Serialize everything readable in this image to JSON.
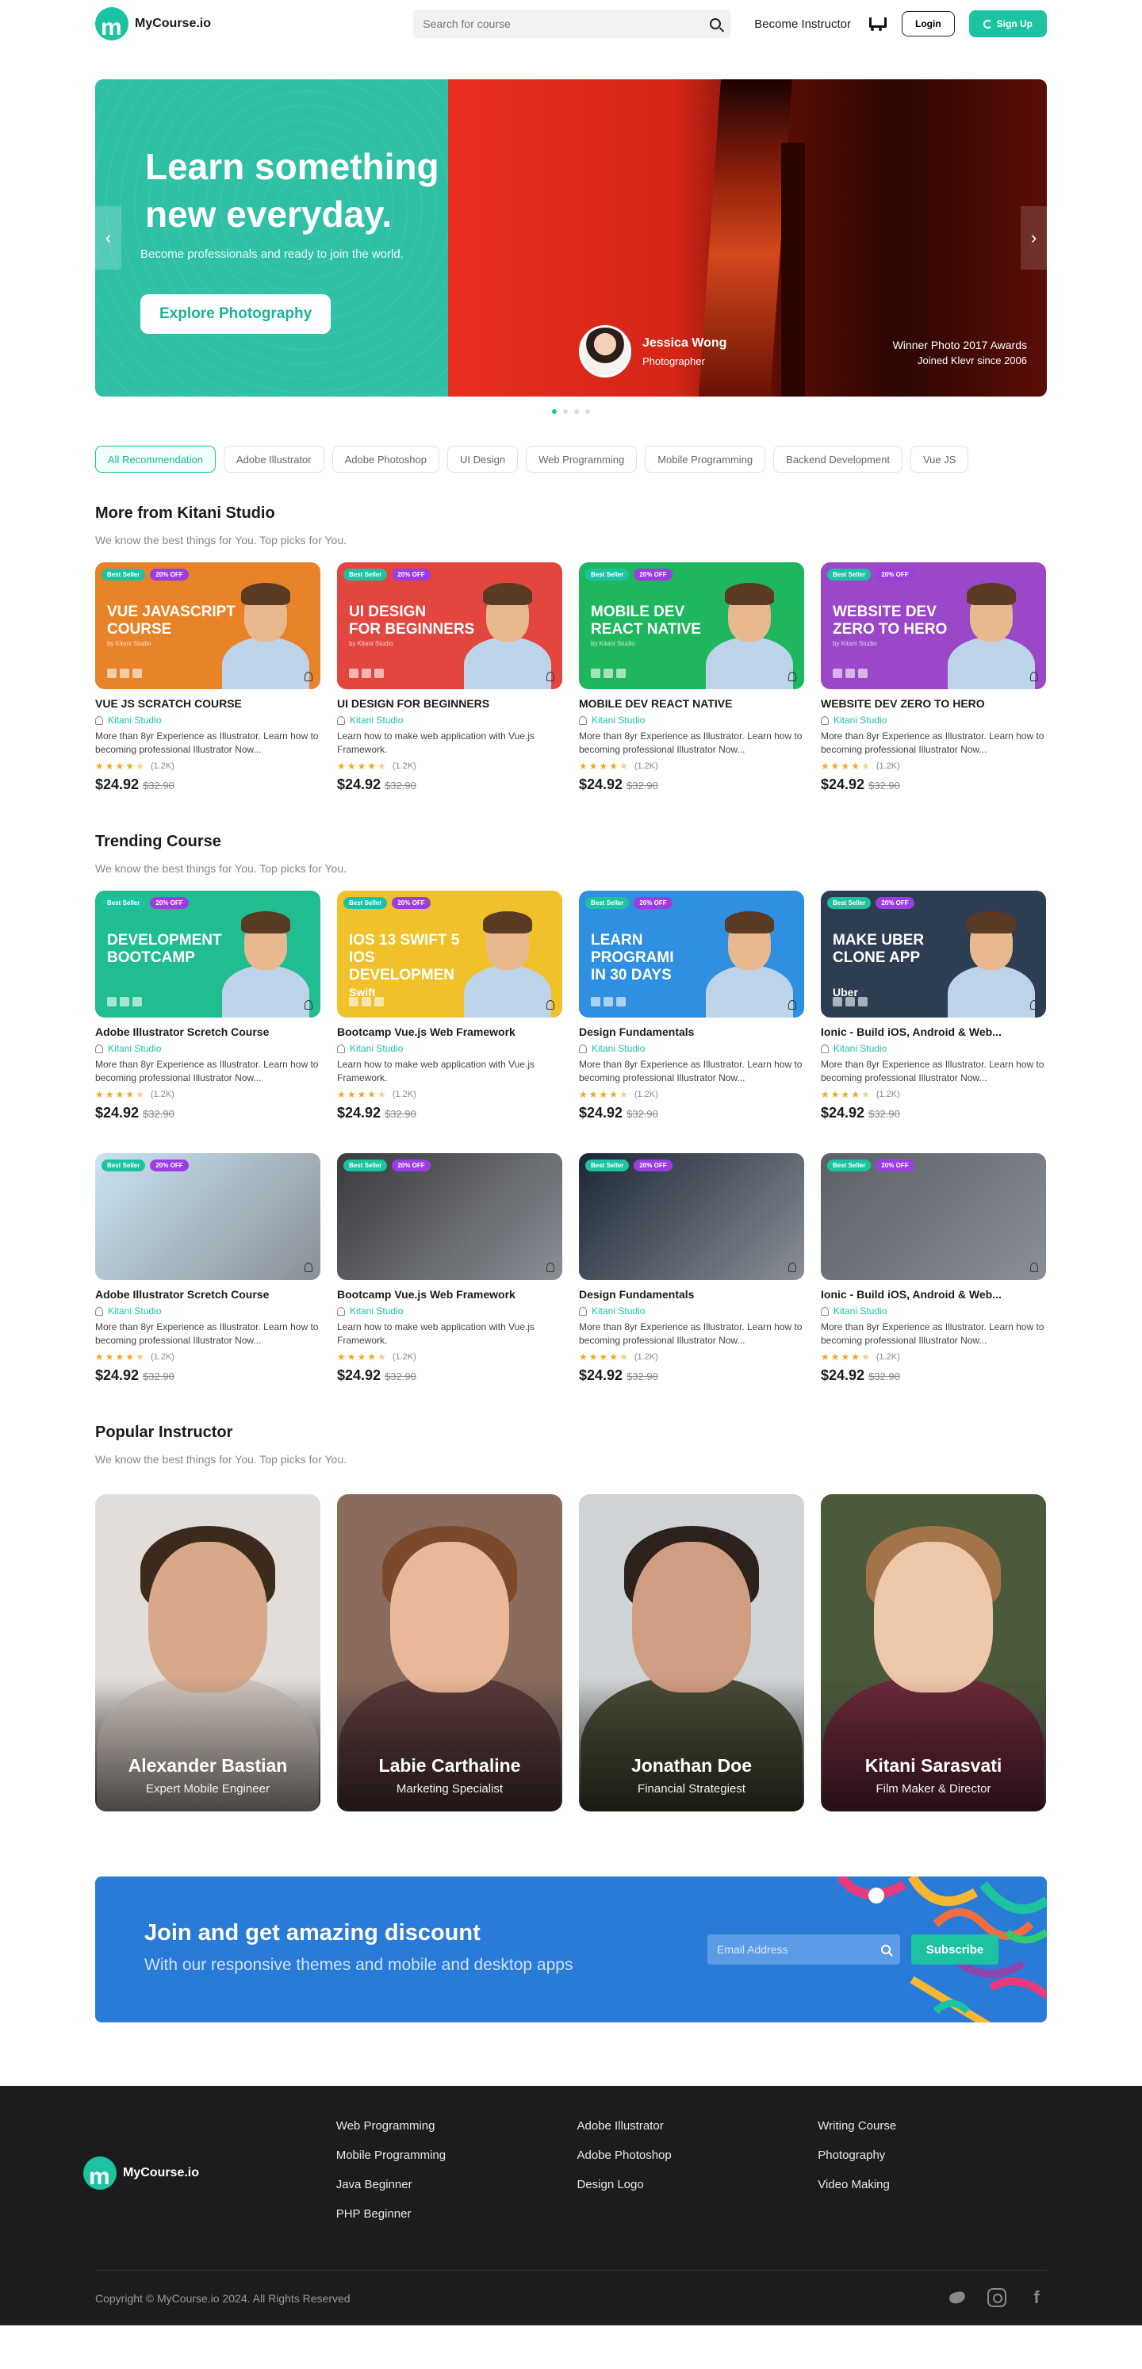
{
  "header": {
    "logo_text": "MyCourse.io",
    "search_placeholder": "Search for course",
    "become_instructor": "Become Instructor",
    "login": "Login",
    "signup": "Sign Up"
  },
  "hero": {
    "title": "Learn something new everyday.",
    "subtitle": "Become professionals and ready to join the world.",
    "button": "Explore Photography",
    "person_name": "Jessica Wong",
    "person_role": "Photographer",
    "award_line1": "Winner Photo 2017 Awards",
    "award_line2": "Joined Klevr since 2006",
    "prev_arrow": "‹",
    "next_arrow": "›",
    "slide_count": 4,
    "active_slide": 1
  },
  "filters": [
    "All Recommendation",
    "Adobe Illustrator",
    "Adobe Photoshop",
    "UI Design",
    "Web Programming",
    "Mobile Programming",
    "Backend Development",
    "Vue JS"
  ],
  "active_filter": 0,
  "sections": {
    "kitani": {
      "title": "More from Kitani Studio",
      "subtitle": "We know the best things for You.  Top picks for You."
    },
    "trending": {
      "title": "Trending Course",
      "subtitle": "We know the best things for You.  Top picks for You."
    },
    "popular": {
      "title": "Popular Instructor",
      "subtitle": "We know the best things for You.  Top picks for You."
    }
  },
  "card_common": {
    "badge1": "Best Seller",
    "badge2": "20% OFF",
    "author": "Kitani Studio",
    "byline": "by Kitani Studio",
    "reviews": "(1.2K)",
    "price": "$24.92",
    "old_price": "$32.90",
    "rating": 4.5
  },
  "kitani_cards": [
    {
      "thumb_text": "VUE JAVASCRIPT\nCOURSE",
      "title": "VUE JS SCRATCH COURSE",
      "desc": "More than 8yr Experience as Illustrator. Learn how to becoming professional Illustrator Now...",
      "color": "#e8832a"
    },
    {
      "thumb_text": "UI DESIGN\nFOR BEGINNERS",
      "title": "UI DESIGN FOR BEGINNERS",
      "desc": "Learn how to make web application with Vue.js Framework.",
      "color": "#e2463f"
    },
    {
      "thumb_text": "MOBILE DEV\nREACT NATIVE",
      "title": "MOBILE DEV REACT NATIVE",
      "desc": "More than 8yr Experience as Illustrator. Learn how to becoming professional Illustrator Now...",
      "color": "#1fb75e"
    },
    {
      "thumb_text": "WEBSITE DEV\nZERO TO HERO",
      "title": "WEBSITE DEV ZERO TO HERO",
      "desc": "More than 8yr Experience as Illustrator. Learn how to becoming professional Illustrator Now...",
      "color": "#9a47c8"
    }
  ],
  "trending_cards": [
    {
      "thumb_text": "DEVELOPMENT\nBOOTCAMP",
      "title": "Adobe Illustrator Scretch Course",
      "desc": "More than 8yr Experience as Illustrator. Learn how to becoming professional Illustrator Now...",
      "color": "#20bd91"
    },
    {
      "thumb_text": "IOS 13 SWIFT 5\nIOS DEVELOPMEN",
      "title": "Bootcamp  Vue.js Web Framework",
      "desc": "Learn how to make web application with Vue.js Framework.",
      "color": "#f0c12a",
      "brand": "Swift"
    },
    {
      "thumb_text": "LEARN PROGRAMI\nIN 30 DAYS",
      "title": "Design Fundamentals",
      "desc": "More than 8yr Experience as Illustrator. Learn how to becoming professional Illustrator Now...",
      "color": "#2f8fe0"
    },
    {
      "thumb_text": "MAKE UBER\nCLONE APP",
      "title": "Ionic - Build iOS, Android & Web...",
      "desc": "More than 8yr Experience as Illustrator. Learn how to becoming professional Illustrator Now...",
      "color": "#2d3d52",
      "brand": "Uber"
    }
  ],
  "photo_cards": [
    {
      "title": "Adobe Illustrator Scretch Course",
      "desc": "More than 8yr Experience as Illustrator. Learn how to becoming professional Illustrator Now...",
      "color": "#c9e4f3"
    },
    {
      "title": "Bootcamp  Vue.js Web Framework",
      "desc": "Learn how to make web application with Vue.js Framework.",
      "color": "#3a3a3c"
    },
    {
      "title": "Design Fundamentals",
      "desc": "More than 8yr Experience as Illustrator. Learn how to becoming professional Illustrator Now...",
      "color": "#1c2736"
    },
    {
      "title": "Ionic - Build iOS, Android & Web...",
      "desc": "More than 8yr Experience as Illustrator. Learn how to becoming professional Illustrator Now...",
      "color": "#5b6066"
    }
  ],
  "instructors": [
    {
      "name": "Alexander Bastian",
      "role": "Expert Mobile Engineer",
      "bg": "#e2ddd9",
      "skin": "#d7a88a",
      "hair": "#3c2a1c",
      "shirt": "#cfc4bd"
    },
    {
      "name": "Labie Carthaline",
      "role": "Marketing Specialist",
      "bg": "#8a6b5c",
      "skin": "#e8b898",
      "hair": "#7a4a2a",
      "shirt": "#5a3a3a"
    },
    {
      "name": "Jonathan Doe",
      "role": "Financial Strategiest",
      "bg": "#cfd3d5",
      "skin": "#cf9e82",
      "hair": "#2c211b",
      "shirt": "#4a4a36"
    },
    {
      "name": "Kitani Sarasvati",
      "role": "Film Maker & Director",
      "bg": "#4b5a3a",
      "skin": "#eec6a8",
      "hair": "#a3744a",
      "shirt": "#6b2a3a"
    }
  ],
  "banner": {
    "title": "Join and get amazing discount",
    "subtitle": "With our responsive themes and mobile and desktop apps",
    "email_placeholder": "Email Address",
    "button": "Subscribe"
  },
  "footer": {
    "logo_text": "MyCourse.io",
    "col1": [
      "Web Programming",
      "Mobile Programming",
      "Java Beginner",
      "PHP Beginner"
    ],
    "col2": [
      "Adobe Illustrator",
      "Adobe Photoshop",
      "Design Logo"
    ],
    "col3": [
      "Writing Course",
      "Photography",
      "Video Making"
    ],
    "copyright": "Copyright © MyCourse.io 2024. All Rights Reserved",
    "social": [
      "twitter-icon",
      "instagram-icon",
      "facebook-icon"
    ],
    "facebook_glyph": "f"
  },
  "colors": {
    "accent": "#1cc3a0",
    "banner": "#2a7ad8",
    "footer": "#1c1c1c",
    "badge_purple": "#9b3de0"
  }
}
